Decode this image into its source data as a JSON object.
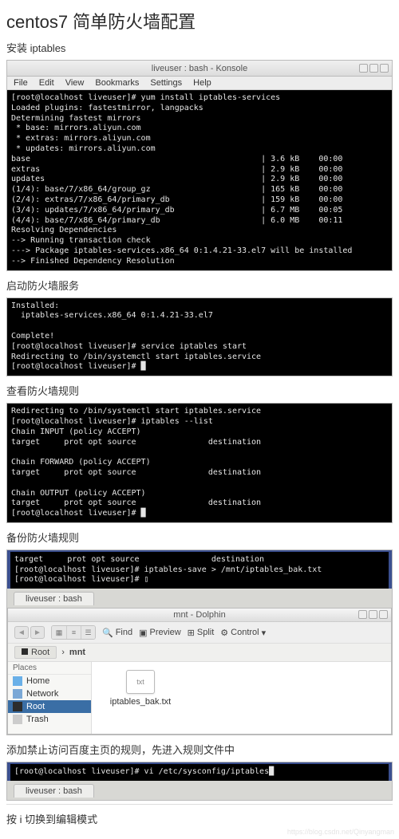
{
  "page_title": "centos7 简单防火墙配置",
  "caption_install": "安装 iptables",
  "konsole": {
    "title": "liveuser : bash - Konsole",
    "menu": [
      "File",
      "Edit",
      "View",
      "Bookmarks",
      "Settings",
      "Help"
    ]
  },
  "term_install_lines": "[root@localhost liveuser]# yum install iptables-services\nLoaded plugins: fastestmirror, langpacks\nDetermining fastest mirrors\n * base: mirrors.aliyun.com\n * extras: mirrors.aliyun.com\n * updates: mirrors.aliyun.com\nbase                                                | 3.6 kB    00:00\nextras                                              | 2.9 kB    00:00\nupdates                                             | 2.9 kB    00:00\n(1/4): base/7/x86_64/group_gz                       | 165 kB    00:00\n(2/4): extras/7/x86_64/primary_db                   | 159 kB    00:00\n(3/4): updates/7/x86_64/primary_db                  | 6.7 MB    00:05\n(4/4): base/7/x86_64/primary_db                     | 6.0 MB    00:11\nResolving Dependencies\n--> Running transaction check\n---> Package iptables-services.x86_64 0:1.4.21-33.el7 will be installed\n--> Finished Dependency Resolution",
  "caption_start": "启动防火墙服务",
  "term_start_lines": "Installed:\n  iptables-services.x86_64 0:1.4.21-33.el7\n\nComplete!\n[root@localhost liveuser]# service iptables start\nRedirecting to /bin/systemctl start iptables.service\n[root@localhost liveuser]# █",
  "caption_list": "查看防火墙规则",
  "term_list_lines": "Redirecting to /bin/systemctl start iptables.service\n[root@localhost liveuser]# iptables --list\nChain INPUT (policy ACCEPT)\ntarget     prot opt source               destination\n\nChain FORWARD (policy ACCEPT)\ntarget     prot opt source               destination\n\nChain OUTPUT (policy ACCEPT)\ntarget     prot opt source               destination\n[root@localhost liveuser]# █",
  "caption_backup": "备份防火墙规则",
  "term_backup_lines": "target     prot opt source               destination\n[root@localhost liveuser]# iptables-save > /mnt/iptables_bak.txt\n[root@localhost liveuser]# ▯",
  "tab_label": "liveuser : bash",
  "dolphin": {
    "title": "mnt - Dolphin",
    "toolbar": {
      "find": "Find",
      "preview": "Preview",
      "split": "Split",
      "control": "Control"
    },
    "path_root": "Root",
    "path_current": "mnt",
    "places_header": "Places",
    "places": {
      "home": "Home",
      "network": "Network",
      "root": "Root",
      "trash": "Trash"
    },
    "file_ext": "txt",
    "file_name": "iptables_bak.txt"
  },
  "caption_addrule": "添加禁止访问百度主页的规则，先进入规则文件中",
  "term_vi_line": "[root@localhost liveuser]# vi /etc/sysconfig/iptables█",
  "caption_vi_mode": "按 i 切换到编辑模式",
  "watermark": "https://blog.csdn.net/Qinyangman"
}
